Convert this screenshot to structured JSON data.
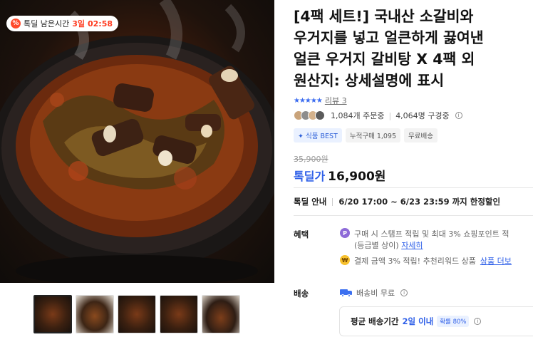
{
  "deal_badge": {
    "icon": "%",
    "label": "톡딜 남은시간",
    "days": "3일",
    "time": "02:58"
  },
  "product": {
    "title_lines": [
      "[4팩 세트!] 국내산 소갈비와",
      "우거지를 넣고 얼큰하게 끓여낸",
      "얼큰 우거지 갈비탕 X 4팩 외",
      "원산지: 상세설명에 표시"
    ],
    "rating_stars": "★★★★★",
    "rating_value": 5,
    "review_link": "리뷰 3",
    "orders": "1,084개 주문중",
    "subscribers": "4,064명 구경중",
    "tags": [
      "식품 BEST",
      "누적구매 1,095",
      "무료배송"
    ],
    "original_price": "35,900원",
    "price_label": "톡딜가",
    "price": "16,900원"
  },
  "deal_info": {
    "label": "톡딜 안내",
    "period": "6/20 17:00 ~ 6/23 23:59 까지 한정할인"
  },
  "benefits": {
    "label": "혜택",
    "line1": "구매 시 스탬프 적립 및 최대 3% 쇼핑포인트 적",
    "line1_cont": "(등급별 상이)",
    "line1_link": "자세히",
    "line2": "결제 금액 3% 적립! 추천리워드 상품",
    "line2_link": "상품 더보"
  },
  "shipping": {
    "label": "배송",
    "fee": "배송비 무료",
    "avg_label": "평균 배송기간",
    "avg_value": "2일 이내",
    "rate": "확률 80%"
  },
  "colors": {
    "accent": "#2e5fe8",
    "deal_red": "#ff3a1f"
  }
}
